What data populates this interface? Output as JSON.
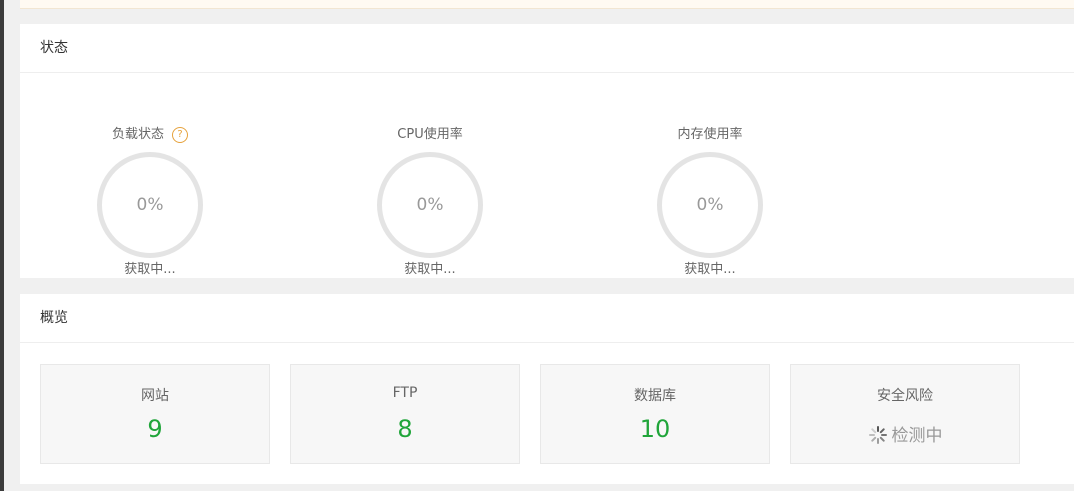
{
  "status_panel": {
    "title": "状态",
    "gauges": [
      {
        "title": "负载状态",
        "value": "0%",
        "status": "获取中..."
      },
      {
        "title": "CPU使用率",
        "value": "0%",
        "status": "获取中..."
      },
      {
        "title": "内存使用率",
        "value": "0%",
        "status": "获取中..."
      }
    ],
    "help_icon": "?"
  },
  "overview_panel": {
    "title": "概览",
    "cards": [
      {
        "label": "网站",
        "value": "9"
      },
      {
        "label": "FTP",
        "value": "8"
      },
      {
        "label": "数据库",
        "value": "10"
      },
      {
        "label": "安全风险",
        "value": "检测中"
      }
    ]
  },
  "colors": {
    "accent_green": "#20a53a",
    "help_orange": "#e6a23c"
  },
  "icons": [
    "help-icon",
    "loading-spinner-icon"
  ]
}
